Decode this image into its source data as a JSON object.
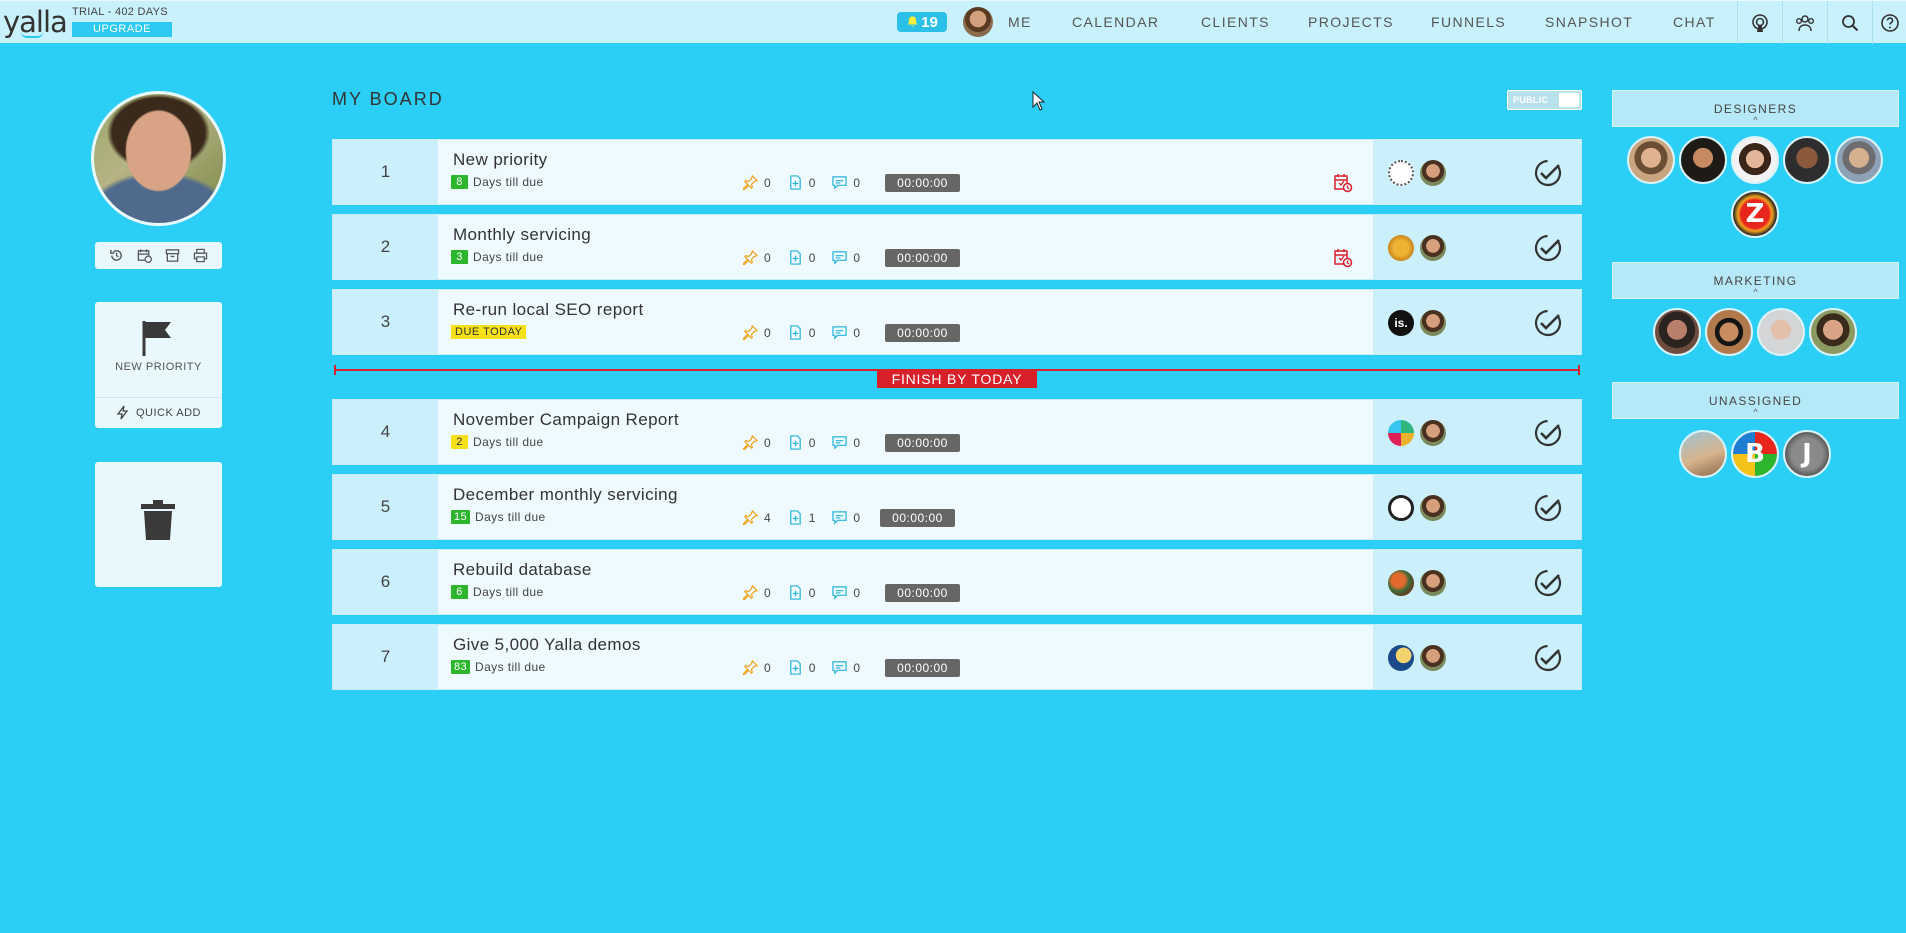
{
  "app": {
    "logo": "yalla",
    "trial": "TRIAL - 402 DAYS",
    "upgrade": "UPGRADE"
  },
  "nav": {
    "notifications": "19",
    "links": [
      "ME",
      "CALENDAR",
      "CLIENTS",
      "PROJECTS",
      "FUNNELS",
      "SNAPSHOT",
      "CHAT"
    ],
    "icons": [
      "podcast-icon",
      "team-icon",
      "search-icon",
      "help-icon"
    ]
  },
  "sidebar": {
    "new_priority": "NEW PRIORITY",
    "quick_add": "QUICK ADD"
  },
  "board": {
    "title": "MY BOARD",
    "visibility": "PUBLIC",
    "finish_label": "FINISH BY TODAY",
    "rows": [
      {
        "num": "1",
        "title": "New priority",
        "badge": "8",
        "badge_color": "green",
        "due_text": "Days till due",
        "pins": "0",
        "files": "0",
        "comments": "0",
        "timer": "00:00:00",
        "overdue": true
      },
      {
        "num": "2",
        "title": "Monthly servicing",
        "badge": "3",
        "badge_color": "green",
        "due_text": "Days till due",
        "pins": "0",
        "files": "0",
        "comments": "0",
        "timer": "00:00:00",
        "overdue": true
      },
      {
        "num": "3",
        "title": "Re-run local SEO report",
        "due_today": "DUE TODAY",
        "pins": "0",
        "files": "0",
        "comments": "0",
        "timer": "00:00:00",
        "overdue": false
      },
      {
        "num": "4",
        "title": "November Campaign Report",
        "badge": "2",
        "badge_color": "yellow",
        "due_text": "Days till due",
        "pins": "0",
        "files": "0",
        "comments": "0",
        "timer": "00:00:00",
        "overdue": false
      },
      {
        "num": "5",
        "title": "December monthly servicing",
        "badge": "15",
        "badge_color": "green",
        "due_text": "Days till due",
        "pins": "4",
        "files": "1",
        "comments": "0",
        "timer": "00:00:00",
        "overdue": false
      },
      {
        "num": "6",
        "title": "Rebuild database",
        "badge": "6",
        "badge_color": "green",
        "due_text": "Days till due",
        "pins": "0",
        "files": "0",
        "comments": "0",
        "timer": "00:00:00",
        "overdue": false
      },
      {
        "num": "7",
        "title": "Give 5,000 Yalla demos",
        "badge": "83",
        "badge_color": "green",
        "due_text": "Days till due",
        "pins": "0",
        "files": "0",
        "comments": "0",
        "timer": "00:00:00",
        "overdue": false
      }
    ]
  },
  "teams": [
    {
      "name": "DESIGNERS"
    },
    {
      "name": "MARKETING"
    },
    {
      "name": "UNASSIGNED",
      "letters": [
        "B",
        "J"
      ]
    }
  ],
  "designers_letter": "Z",
  "client_logo_text": "is.",
  "colors": {
    "background": "#2bcff6",
    "accent": "#2ec9f0",
    "danger": "#d8202a",
    "badge_green": "#2db52d",
    "badge_yellow": "#f5e11a"
  }
}
